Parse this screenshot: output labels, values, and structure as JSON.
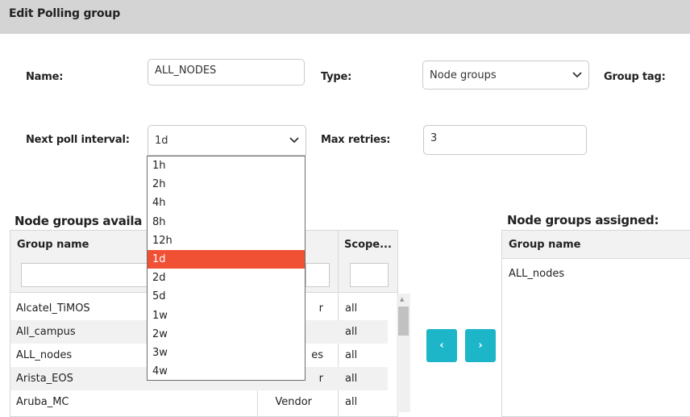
{
  "header": {
    "title": "Edit Polling group"
  },
  "form": {
    "name_label": "Name:",
    "name_value": "ALL_NODES",
    "type_label": "Type:",
    "type_value": "Node groups",
    "group_tag_label": "Group tag:",
    "interval_label": "Next poll interval:",
    "interval_value": "1d",
    "retries_label": "Max retries:",
    "retries_value": "3"
  },
  "interval_options": [
    "1h",
    "2h",
    "4h",
    "8h",
    "12h",
    "1d",
    "2d",
    "5d",
    "1w",
    "2w",
    "3w",
    "4w"
  ],
  "interval_selected_index": 5,
  "available": {
    "title": "Node groups availa",
    "columns": {
      "name": "Group name",
      "type": "",
      "scope": "Scope..."
    },
    "rows": [
      {
        "name": "Alcatel_TiMOS",
        "type": "r",
        "scope": "all"
      },
      {
        "name": "All_campus",
        "type": "",
        "scope": "all"
      },
      {
        "name": "ALL_nodes",
        "type": "es",
        "scope": "all"
      },
      {
        "name": "Arista_EOS",
        "type": "r",
        "scope": "all"
      },
      {
        "name": "Aruba_MC",
        "type": "Vendor",
        "scope": "all"
      }
    ]
  },
  "buttons": {
    "move_left": "‹",
    "move_right": "›"
  },
  "assigned": {
    "title": "Node groups assigned:",
    "columns": {
      "name": "Group name"
    },
    "rows": [
      {
        "name": "ALL_nodes"
      }
    ]
  },
  "colors": {
    "accent": "#1cb6c8",
    "selected_option": "#f05033",
    "header_bg": "#d4d4d4"
  }
}
